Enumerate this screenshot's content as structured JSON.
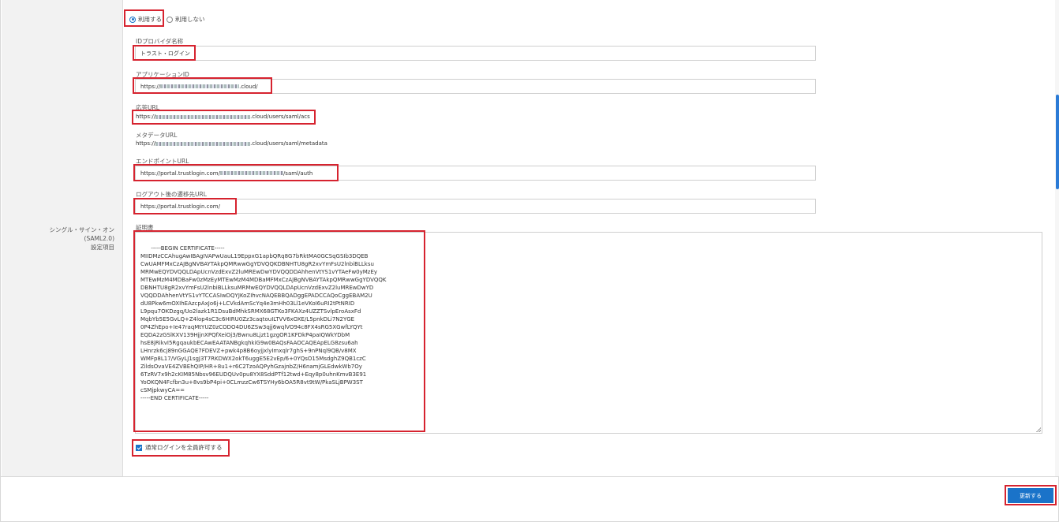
{
  "section_label": [
    "シングル・サイン・オン",
    "(SAML2.0)",
    "設定項目"
  ],
  "radio": {
    "use": "利用する",
    "not_use": "利用しない"
  },
  "fields": {
    "idp_name": {
      "label": "IDプロバイダ名称",
      "value": "トラスト・ログイン"
    },
    "app_id": {
      "label": "アプリケーションID",
      "prefix": "https://",
      "suffix": ".cloud/"
    },
    "acs_url": {
      "label": "応答URL",
      "prefix": "https://",
      "suffix": ".cloud/users/saml/acs"
    },
    "metadata_url": {
      "label": "メタデータURL",
      "prefix": "https://",
      "suffix": ".cloud/users/saml/metadata"
    },
    "endpoint_url": {
      "label": "エンドポイントURL",
      "prefix": "https://portal.trustlogin.com/",
      "suffix": "/saml/auth"
    },
    "logout_url": {
      "label": "ログアウト後の遷移先URL",
      "value": "https://portal.trustlogin.com/"
    },
    "certificate": {
      "label": "証明書"
    }
  },
  "certificate_text": "-----BEGIN CERTIFICATE-----\nMIIDMzCCAhugAwIBAgIVAPwUauL19EppxG1apbQRq8G7bRktMA0GCSqGSIb3DQEB\nCwUAMFMxCzAJBgNVBAYTAkpQMRwwGgYDVQQKDBNHTU8gR2xvYmFsU2lnbiBLLksu\nMRMwEQYDVQQLDApUcnVzdExvZ2luMREwDwYDVQQDDAhhenVtYS1vYTAeFw0yMzEy\nMTEwMzM4MDBaFw0zMzEyMTEwMzM4MDBaMFMxCzAJBgNVBAYTAkpQMRwwGgYDVQQK\nDBNHTU8gR2xvYmFsU2lnbiBLLksuMRMwEQYDVQQLDApUcnVzdExvZ2luMREwDwYD\nVQQDDAhhenVtYS1vYTCCASIwDQYJKoZIhvcNAQEBBQADggEPADCCAQoCggEBAM2U\ndU8Pkw6mOXIhEAzcpAxJo6j+LCVkdAmScYq4e3mHh03Ll1eVKoI6uRI2tPtNRID\nL9pqu7OKDzgq/Uo2lazk1R1DsuBdMhkSRMX68GTKo3FKAXz4UZZTSvlpEroAsxFd\nMqbYb5E5GvLQ+Z4lop4sC3c6HIRU0Zz3caqtouILTVV6xOXE/L5pnkDLi7N2YGE\n0P4ZhEpo+Ie47raqMtYUZ0zCODO4DU6ZSw3qjj6wqlVO94c8FX4sRG5XGwfLYQYt\nEQDA2zGSlKXV139HjjnXPQfXeiOj3/Bwnu8Ljzt1gzgOR1KFDkP4paIQWkYDbM\nhsE8jRikvI5RgqaukbECAwEAATANBgkqhkiG9w0BAQsFAAOCAQEApELG8zsu6ah\nLHnrzk6cj89nGGAQE7FDEVZ+pwk4p8B6oyjjxlyImxqlr7ghS+9nPNql9QB/v8MX\nWMFp8L17/VGyLJ1sgJ3T7RKDWX2okT6uggE5E2vEp/6+0YQsO15MsdghZ9QB1czC\nZildsOvaVE4ZVBEhQIP/HR+8u1+r6C2TzoAQPyhGzajnbZ/H6namjGLEdwkWb7Oy\n6TzRV7x9h2cKIM85Nbsv96EUDQUv0pu8YX8SddPTf12twd+Eqy8p0uhnKmvB3E91\nYoOKQN4Fcfbn3u+8vs9bP4pi+0CLmzzCw6TSYHy6bOA5R8vt9tW/PkaSLjBPW3ST\ncSMjpkwyCA==\n-----END CERTIFICATE-----",
  "checkbox": {
    "label": "通常ログインを全員許可する"
  },
  "update_button": "更新する",
  "colors": {
    "accent": "#1a73c9",
    "highlight": "#d6232f"
  }
}
